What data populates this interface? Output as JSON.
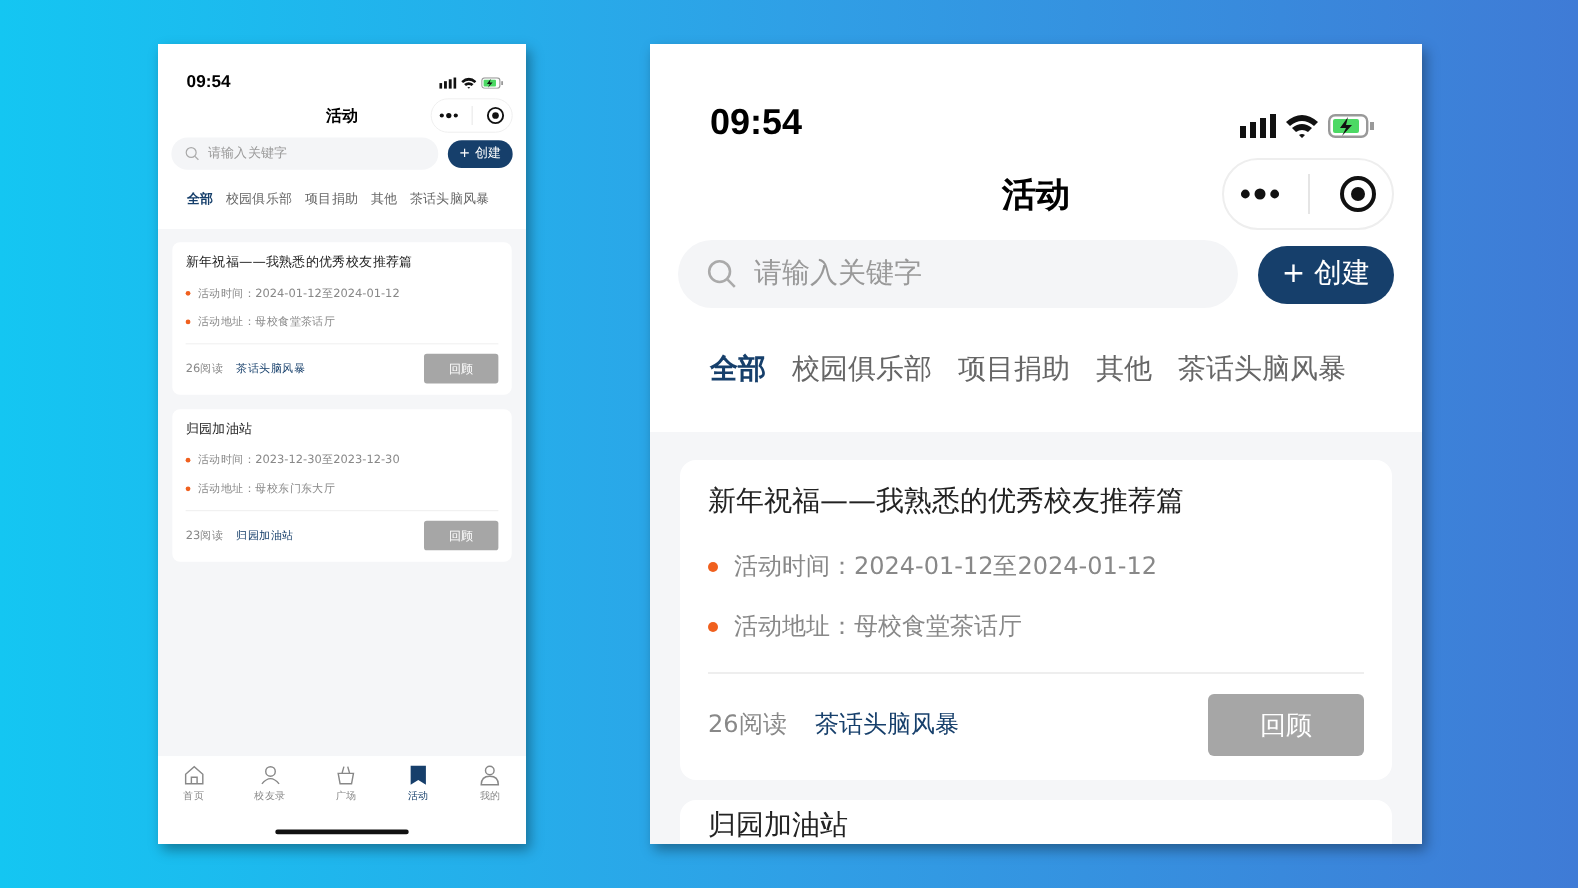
{
  "phones": [
    {
      "kind": "small",
      "status_bar": {
        "time": "09:54"
      },
      "title": "活动",
      "search": {
        "placeholder": "请输入关键字"
      },
      "create_button": "+ 创建",
      "tabs": [
        {
          "label": "全部",
          "selected": true
        },
        {
          "label": "校园俱乐部",
          "selected": false
        },
        {
          "label": "项目捐助",
          "selected": false
        },
        {
          "label": "其他",
          "selected": false
        },
        {
          "label": "茶话头脑风暴",
          "selected": false
        }
      ],
      "cards": [
        {
          "title": "新年祝福——我熟悉的优秀校友推荐篇",
          "info": [
            "活动时间：2024-01-12至2024-01-12",
            "活动地址：母校食堂茶话厅"
          ],
          "reads": "26阅读",
          "tag": "茶话头脑风暴",
          "button": "回顾"
        },
        {
          "title": "归园加油站",
          "info": [
            "活动时间：2023-12-30至2023-12-30",
            "活动地址：母校东门东大厅"
          ],
          "reads": "23阅读",
          "tag": "归园加油站",
          "button": "回顾"
        }
      ],
      "tab_bar": [
        {
          "label": "首页",
          "selected": false
        },
        {
          "label": "校友录",
          "selected": false
        },
        {
          "label": "广场",
          "selected": false
        },
        {
          "label": "活动",
          "selected": true
        },
        {
          "label": "我的",
          "selected": false
        }
      ]
    },
    {
      "kind": "large",
      "status_bar": {
        "time": "09:54"
      },
      "title": "活动",
      "search": {
        "placeholder": "请输入关键字"
      },
      "create_button": "+ 创建",
      "tabs": [
        {
          "label": "全部",
          "selected": true
        },
        {
          "label": "校园俱乐部",
          "selected": false
        },
        {
          "label": "项目捐助",
          "selected": false
        },
        {
          "label": "其他",
          "selected": false
        },
        {
          "label": "茶话头脑风暴",
          "selected": false
        }
      ],
      "cards": [
        {
          "title": "新年祝福——我熟悉的优秀校友推荐篇",
          "info": [
            "活动时间：2024-01-12至2024-01-12",
            "活动地址：母校食堂茶话厅"
          ],
          "reads": "26阅读",
          "tag": "茶话头脑风暴",
          "button": "回顾"
        },
        {
          "title": "归园加油站"
        }
      ]
    }
  ]
}
